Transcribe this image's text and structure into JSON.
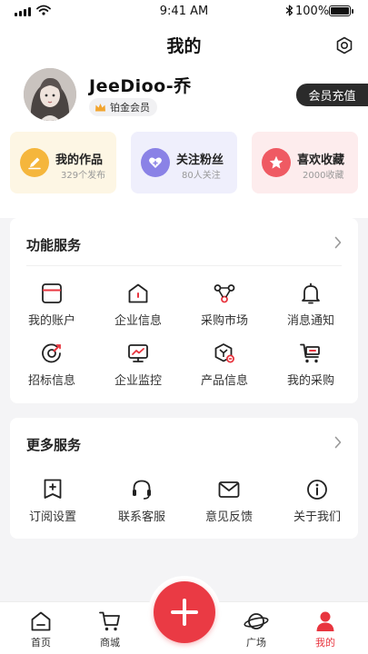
{
  "status_bar": {
    "time": "9:41 AM",
    "battery": "100%"
  },
  "page_title": "我的",
  "profile": {
    "name": "JeeDioo-乔",
    "badge": "铂金会员",
    "vip_button": "会员充值"
  },
  "stats": [
    {
      "label": "我的作品",
      "sub": "329个发布",
      "icon": "pen-edit-icon",
      "bg": "#fdf6e4",
      "icon_bg": "#f5b63c"
    },
    {
      "label": "关注粉丝",
      "sub": "80人关注",
      "icon": "heart-plus-icon",
      "bg": "#efeffc",
      "icon_bg": "#8a82e6"
    },
    {
      "label": "喜欢收藏",
      "sub": "2000收藏",
      "icon": "star-icon",
      "bg": "#fdeced",
      "icon_bg": "#ef5a63"
    }
  ],
  "function_services": {
    "title": "功能服务",
    "items": [
      {
        "label": "我的账户",
        "icon": "wallet-icon"
      },
      {
        "label": "企业信息",
        "icon": "company-home-icon"
      },
      {
        "label": "采购市场",
        "icon": "market-nodes-icon"
      },
      {
        "label": "消息通知",
        "icon": "bell-icon"
      },
      {
        "label": "招标信息",
        "icon": "bid-target-icon"
      },
      {
        "label": "企业监控",
        "icon": "monitor-chart-icon"
      },
      {
        "label": "产品信息",
        "icon": "product-box-icon"
      },
      {
        "label": "我的采购",
        "icon": "shopping-cart-icon"
      }
    ]
  },
  "more_services": {
    "title": "更多服务",
    "items": [
      {
        "label": "订阅设置",
        "icon": "bookmark-plus-icon"
      },
      {
        "label": "联系客服",
        "icon": "headset-icon"
      },
      {
        "label": "意见反馈",
        "icon": "mail-icon"
      },
      {
        "label": "关于我们",
        "icon": "info-icon"
      }
    ]
  },
  "tabbar": {
    "items": [
      {
        "label": "首页",
        "icon": "home-icon"
      },
      {
        "label": "商城",
        "icon": "cart-icon"
      },
      {
        "label": "广场",
        "icon": "planet-icon"
      },
      {
        "label": "我的",
        "icon": "user-icon",
        "active": true
      }
    ],
    "fab_icon": "plus-icon"
  },
  "colors": {
    "accent": "#e8353f",
    "vip_button_bg": "#2b2b2b",
    "page_bg": "#f4f4f6"
  }
}
